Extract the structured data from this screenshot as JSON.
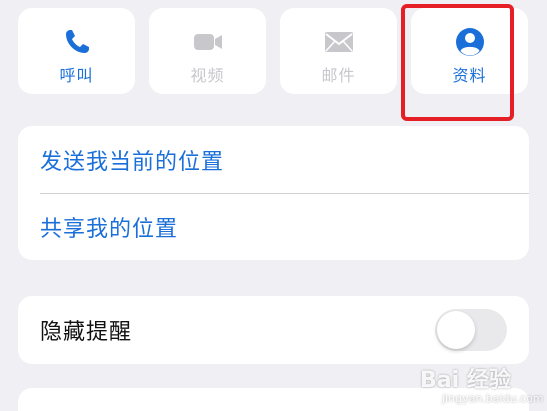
{
  "actions": {
    "call": {
      "label": "呼叫",
      "icon": "phone-icon",
      "enabled": true
    },
    "video": {
      "label": "视频",
      "icon": "video-camera-icon",
      "enabled": false
    },
    "mail": {
      "label": "邮件",
      "icon": "envelope-icon",
      "enabled": false
    },
    "profile": {
      "label": "资料",
      "icon": "person-circle-icon",
      "enabled": true
    }
  },
  "location": {
    "send_current": "发送我当前的位置",
    "share": "共享我的位置"
  },
  "alerts": {
    "hide_label": "隐藏提醒",
    "hide_enabled": false
  },
  "watermark": {
    "main": "Bai 经验",
    "sub": "jingyan.baidu.com"
  },
  "colors": {
    "accent": "#1b6fd9",
    "disabled": "#c7c7cc",
    "highlight": "#e61e25",
    "background": "#efeff4"
  }
}
